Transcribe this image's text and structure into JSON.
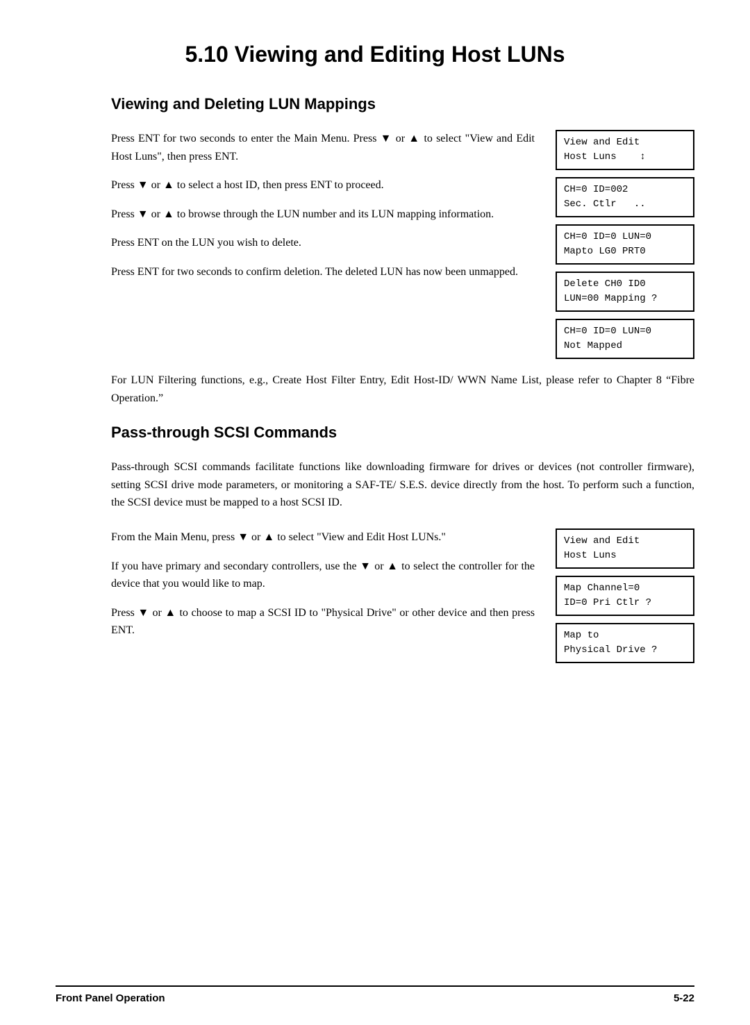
{
  "page": {
    "title": "5.10   Viewing and Editing Host LUNs",
    "footer_left": "Front Panel Operation",
    "footer_right": "5-22"
  },
  "section1": {
    "heading": "Viewing and Deleting LUN Mappings",
    "paragraphs": [
      "Press ENT for two seconds to enter the Main Menu.  Press ▼ or ▲ to select \"View and Edit Host Luns\", then press ENT.",
      "Press ▼ or ▲ to select a host ID, then press ENT to proceed.",
      "Press ▼ or ▲ to browse through the LUN number and its LUN mapping information.",
      "Press ENT on the LUN you wish to delete.",
      "Press ENT for two seconds to confirm deletion. The deleted LUN has now been unmapped."
    ],
    "screens": [
      "View and Edit\nHost Luns    ↕",
      "CH=0 ID=002\nSec. Ctlr   ..",
      "CH=0 ID=0 LUN=0\nMapto LG0 PRT0",
      "Delete CH0 ID0\nLUN=00 Mapping ?",
      "CH=0 ID=0 LUN=0\nNot Mapped"
    ],
    "note": "For LUN Filtering functions, e.g., Create Host Filter Entry, Edit Host-ID/ WWN Name List, please refer to Chapter 8 “Fibre Operation.”"
  },
  "section2": {
    "heading": "Pass-through SCSI Commands",
    "intro": "Pass-through SCSI commands facilitate functions like downloading firmware for drives or devices (not controller firmware), setting SCSI drive mode parameters, or monitoring a SAF-TE/ S.E.S. device directly from the host. To perform such a function, the SCSI device must be mapped to a host SCSI ID.",
    "paragraphs": [
      "From the Main Menu, press ▼ or ▲ to select \"View and Edit Host LUNs.\"",
      "If you have primary and secondary controllers, use the ▼ or ▲ to select the controller for the device that you would like to map.",
      "Press ▼ or ▲ to choose to map a SCSI ID to \"Physical Drive\" or other device and then press ENT."
    ],
    "screens": [
      "View and Edit\nHost Luns",
      "Map Channel=0\nID=0 Pri Ctlr ?",
      "Map to\nPhysical Drive ?"
    ]
  }
}
